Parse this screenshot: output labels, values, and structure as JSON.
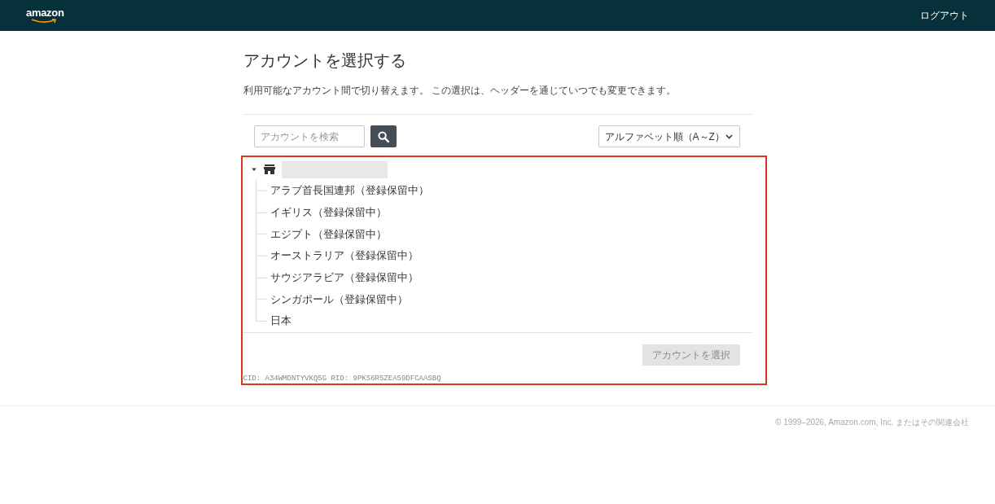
{
  "header": {
    "logo": "amazon",
    "logout": "ログアウト"
  },
  "page": {
    "title": "アカウントを選択する",
    "description": "利用可能なアカウント間で切り替えます。 この選択は、ヘッダーを通じていつでも変更できます。"
  },
  "search": {
    "placeholder": "アカウントを検索"
  },
  "sort": {
    "value": "アルファベット順（A～Z）"
  },
  "tree": {
    "expanded": true,
    "children": [
      {
        "label": "アラブ首長国連邦（登録保留中）"
      },
      {
        "label": "イギリス（登録保留中）"
      },
      {
        "label": "エジプト（登録保留中）"
      },
      {
        "label": "オーストラリア（登録保留中）"
      },
      {
        "label": "サウジアラビア（登録保留中）"
      },
      {
        "label": "シンガポール（登録保留中）"
      },
      {
        "label": "日本"
      }
    ]
  },
  "select_button": {
    "label": "アカウントを選択",
    "disabled": true
  },
  "ids": "CID: A34WMDNTYVKQ5G RID: 9PKS6R5ZEA59DFCAASBQ",
  "footer": {
    "copyright": "© 1999–2026, Amazon.com, Inc. またはその関連会社"
  }
}
